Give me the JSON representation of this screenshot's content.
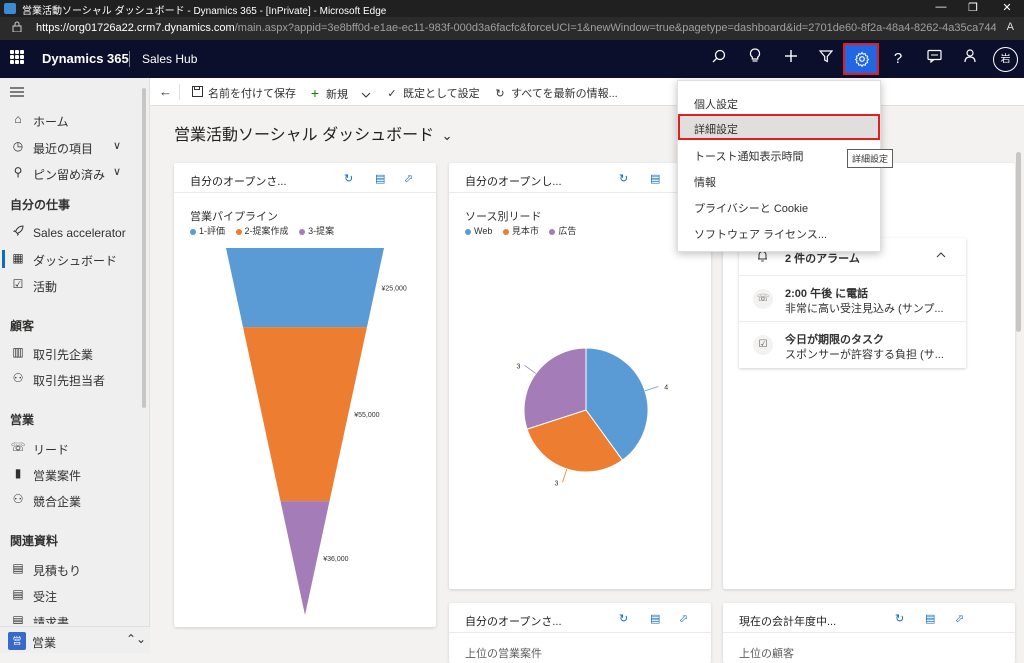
{
  "browser": {
    "title": "営業活動ソーシャル ダッシュボード - Dynamics 365 - [InPrivate] - Microsoft Edge",
    "url_host": "https://org01726a22.crm7.dynamics.com",
    "url_rest": "/main.aspx?appid=3e8bff0d-e1ae-ec11-983f-000d3a6facfc&forceUCI=1&newWindow=true&pagetype=dashboard&id=2701de60-8f2a-48a4-8262-4a35ca7441fa&t...",
    "minimize": "—",
    "restore": "❐",
    "close": "✕",
    "reader": "A"
  },
  "appnav": {
    "brand": "Dynamics 365",
    "hub": "Sales Hub",
    "avatar": "岩"
  },
  "sidebar": {
    "items_top": [
      {
        "label": "ホーム",
        "icon": "home-icon",
        "glyph": "⌂"
      },
      {
        "label": "最近の項目",
        "icon": "clock-icon",
        "glyph": "◷",
        "chevron": "∨"
      },
      {
        "label": "ピン留め済み",
        "icon": "pin-icon",
        "glyph": "⚲",
        "chevron": "∨"
      }
    ],
    "sections": [
      {
        "header": "自分の仕事",
        "items": [
          {
            "label": "Sales accelerator",
            "glyph": "🚀"
          },
          {
            "label": "ダッシュボード",
            "glyph": "▦"
          },
          {
            "label": "活動",
            "glyph": "☑"
          }
        ]
      },
      {
        "header": "顧客",
        "items": [
          {
            "label": "取引先企業",
            "glyph": "▥"
          },
          {
            "label": "取引先担当者",
            "glyph": "⚇"
          }
        ]
      },
      {
        "header": "営業",
        "items": [
          {
            "label": "リード",
            "glyph": "☏"
          },
          {
            "label": "営業案件",
            "glyph": "▮"
          },
          {
            "label": "競合企業",
            "glyph": "⚇"
          }
        ]
      },
      {
        "header": "関連資料",
        "items": [
          {
            "label": "見積もり",
            "glyph": "▤"
          },
          {
            "label": "受注",
            "glyph": "▤"
          },
          {
            "label": "請求書",
            "glyph": "▤"
          }
        ]
      }
    ],
    "area_badge": "営",
    "area_label": "営業",
    "area_switch": "⌃⌄"
  },
  "cmdbar": {
    "back": "←",
    "save_as": "名前を付けて保存",
    "new": "新規",
    "set_default": "既定として設定",
    "refresh_all": "すべてを最新の情報..."
  },
  "page": {
    "title": "営業活動ソーシャル ダッシュボード",
    "title_chevron": "⌄"
  },
  "cards": {
    "c1_title": "自分のオープンさ...",
    "c2_title": "自分のオープンし...",
    "c3_title": "自分のオープンさ...",
    "c4_title": "現在の会計年度中...",
    "c3_sub": "上位の営業案件",
    "c4_sub": "上位の顧客"
  },
  "menu": {
    "items": [
      "個人設定",
      "詳細設定",
      "トースト通知表示時間",
      "情報",
      "プライバシーと Cookie",
      "ソフトウェア ライセンス..."
    ],
    "tooltip": "詳細設定"
  },
  "alarms": {
    "header": "2 件のアラーム",
    "items": [
      {
        "title": "2:00 午後 に電話",
        "sub": "非常に高い受注見込み (サンプ..."
      },
      {
        "title": "今日が期限のタスク",
        "sub": "スポンサーが許容する負担 (サ..."
      }
    ]
  },
  "chart_data": [
    {
      "type": "funnel",
      "title": "営業パイプライン",
      "categories": [
        "1-評価",
        "2-提案作成",
        "3-提案"
      ],
      "values": [
        25000,
        55000,
        36000
      ],
      "labels": [
        "¥25,000",
        "¥55,000",
        "¥36,000"
      ],
      "colors": [
        "#5b9bd5",
        "#ed7d31",
        "#a37cb8"
      ],
      "legend": "top-left"
    },
    {
      "type": "pie",
      "title": "ソース別リード",
      "categories": [
        "Web",
        "見本市",
        "広告"
      ],
      "values": [
        4,
        3,
        3
      ],
      "colors": [
        "#5b9bd5",
        "#ed7d31",
        "#a37cb8"
      ],
      "legend": "top-left"
    }
  ]
}
